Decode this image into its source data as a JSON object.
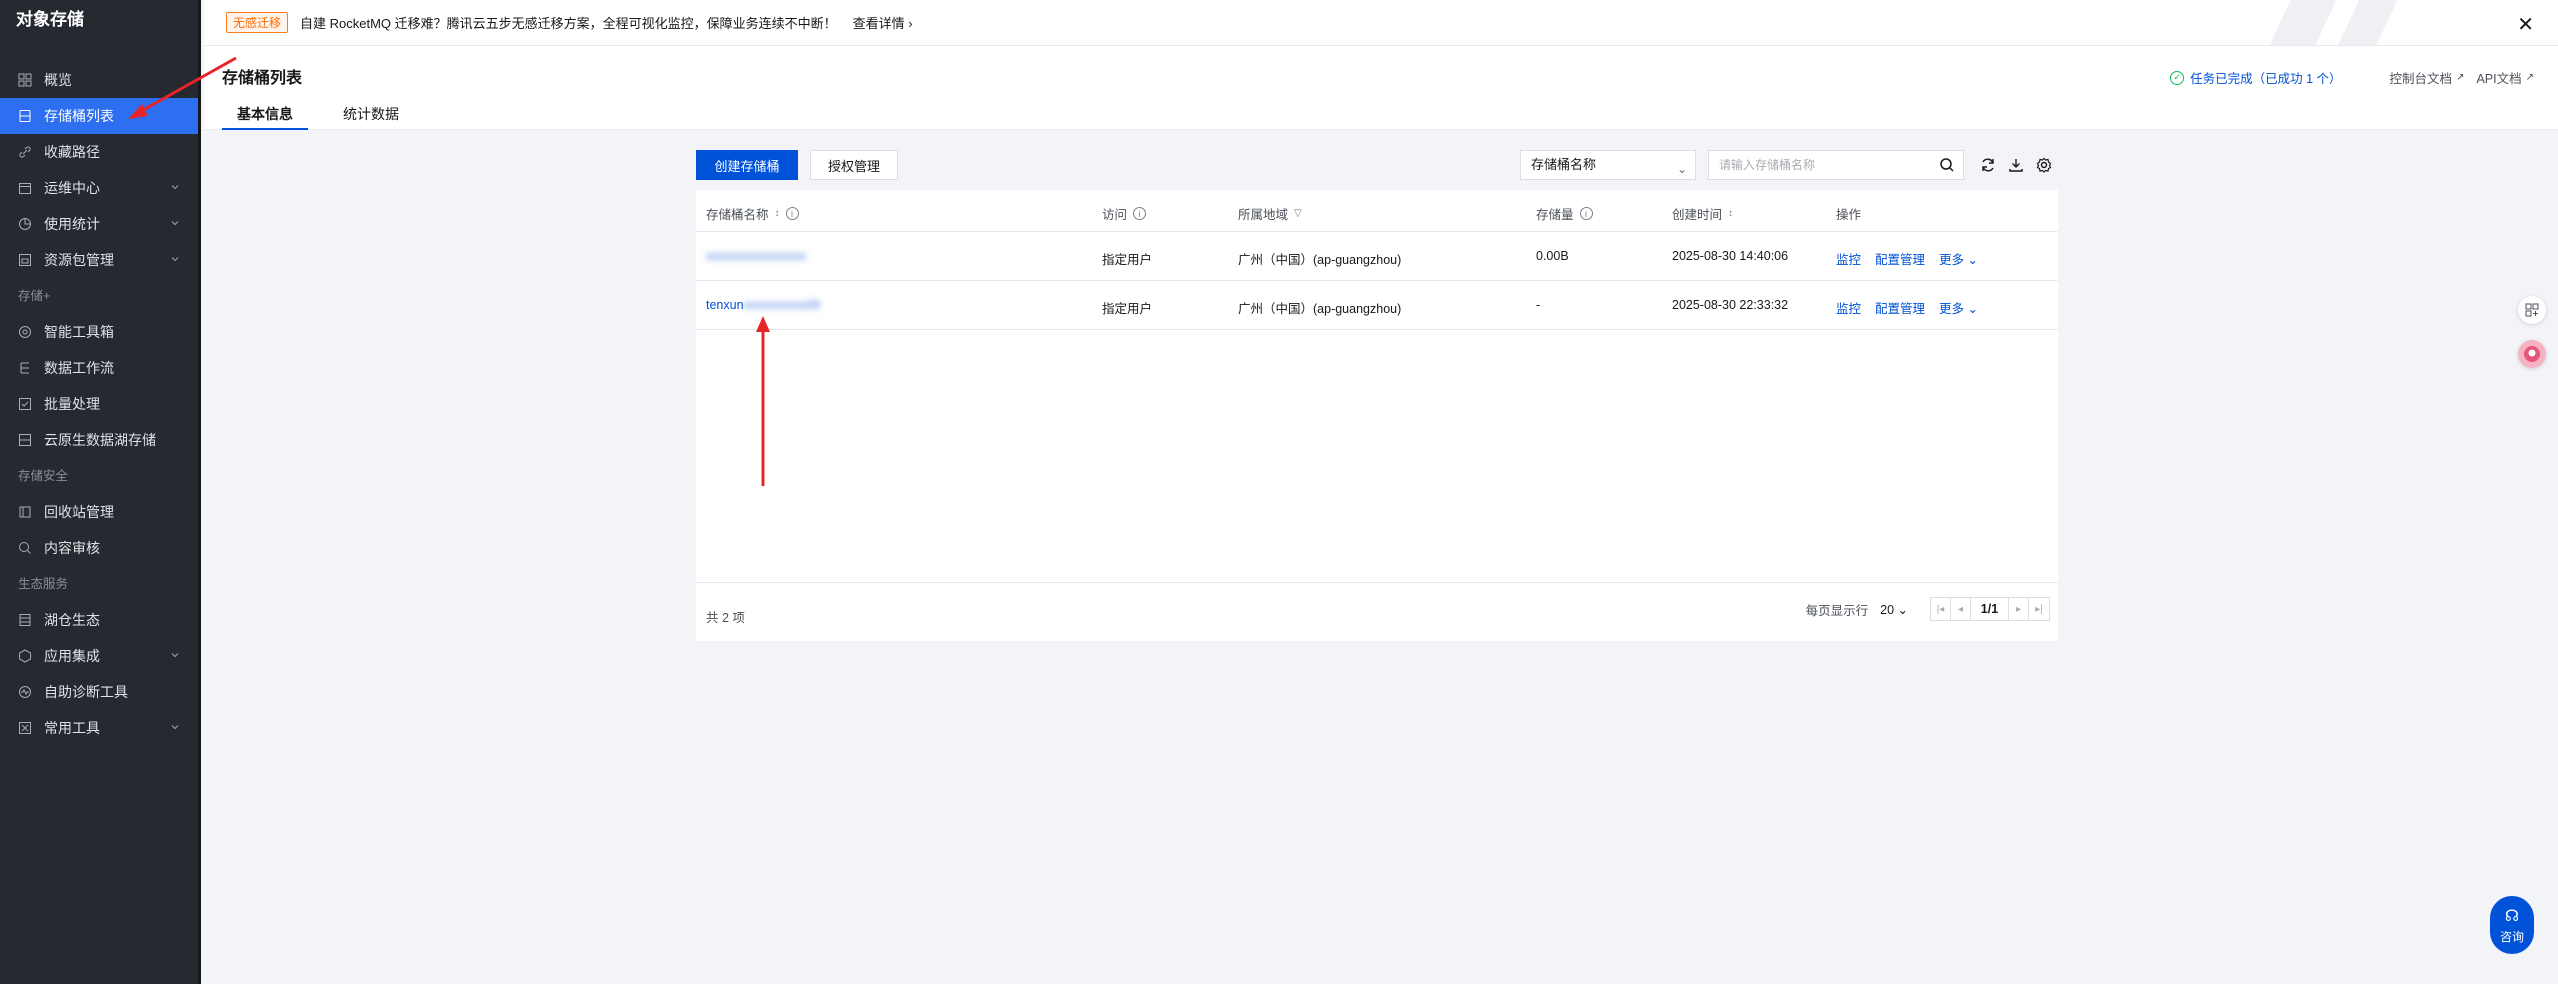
{
  "sidebar": {
    "title": "对象存储",
    "items": [
      {
        "label": "概览",
        "icon": "grid-icon"
      },
      {
        "label": "存储桶列表",
        "icon": "bucket-icon",
        "active": true
      },
      {
        "label": "收藏路径",
        "icon": "link-icon"
      },
      {
        "label": "运维中心",
        "icon": "calendar-icon",
        "expandable": true
      },
      {
        "label": "使用统计",
        "icon": "pie-icon",
        "expandable": true
      },
      {
        "label": "资源包管理",
        "icon": "package-icon",
        "expandable": true
      }
    ],
    "group_storage_plus": "存储+",
    "items_plus": [
      {
        "label": "智能工具箱",
        "icon": "toolbox-icon"
      },
      {
        "label": "数据工作流",
        "icon": "workflow-icon"
      },
      {
        "label": "批量处理",
        "icon": "batch-icon"
      },
      {
        "label": "云原生数据湖存储",
        "icon": "lake-icon"
      }
    ],
    "group_security": "存储安全",
    "items_security": [
      {
        "label": "回收站管理",
        "icon": "trash-icon"
      },
      {
        "label": "内容审核",
        "icon": "audit-icon"
      }
    ],
    "group_eco": "生态服务",
    "items_eco": [
      {
        "label": "湖仓生态",
        "icon": "lakehouse-icon"
      },
      {
        "label": "应用集成",
        "icon": "integration-icon",
        "expandable": true
      },
      {
        "label": "自助诊断工具",
        "icon": "diagnose-icon"
      },
      {
        "label": "常用工具",
        "icon": "tools-icon",
        "expandable": true
      }
    ]
  },
  "banner": {
    "tag": "无感迁移",
    "message": "自建 RocketMQ 迁移难？腾讯云五步无感迁移方案，全程可视化监控，保障业务连续不中断！",
    "detail": "查看详情 ›",
    "close": "✕"
  },
  "header": {
    "title": "存储桶列表",
    "tabs": [
      {
        "label": "基本信息",
        "active": true
      },
      {
        "label": "统计数据"
      }
    ],
    "task_status": "任务已完成（已成功 1 个）",
    "console_doc": "控制台文档",
    "api_doc": "API文档"
  },
  "toolbar": {
    "create_label": "创建存储桶",
    "auth_label": "授权管理",
    "filter_selected": "存储桶名称",
    "search_placeholder": "请输入存储桶名称"
  },
  "table": {
    "columns": [
      "存储桶名称",
      "访问",
      "所属地域",
      "存储量",
      "创建时间",
      "操作"
    ],
    "rows": [
      {
        "name": "xxxxxxxxxxxxxxxx",
        "access": "指定用户",
        "region": "广州（中国）(ap-guangzhou)",
        "storage": "0.00B",
        "created": "2025-08-30 14:40:06"
      },
      {
        "name_visible": "tenxun",
        "name_blurred": "xxxxxxxxxx09",
        "access": "指定用户",
        "region": "广州（中国）(ap-guangzhou)",
        "storage": "-",
        "created": "2025-08-30 22:33:32"
      }
    ],
    "ops": {
      "monitor": "监控",
      "config": "配置管理",
      "more": "更多"
    },
    "total": "共 2 项",
    "page_size_label": "每页显示行",
    "page_size": "20",
    "page": "1/1"
  },
  "floating": {
    "consult": "咨询"
  },
  "colors": {
    "primary": "#0052d9",
    "sidebar_bg": "#262a30",
    "sidebar_active": "#2d6ff0",
    "success": "#0abf5b",
    "annotation": "#e8242a"
  }
}
